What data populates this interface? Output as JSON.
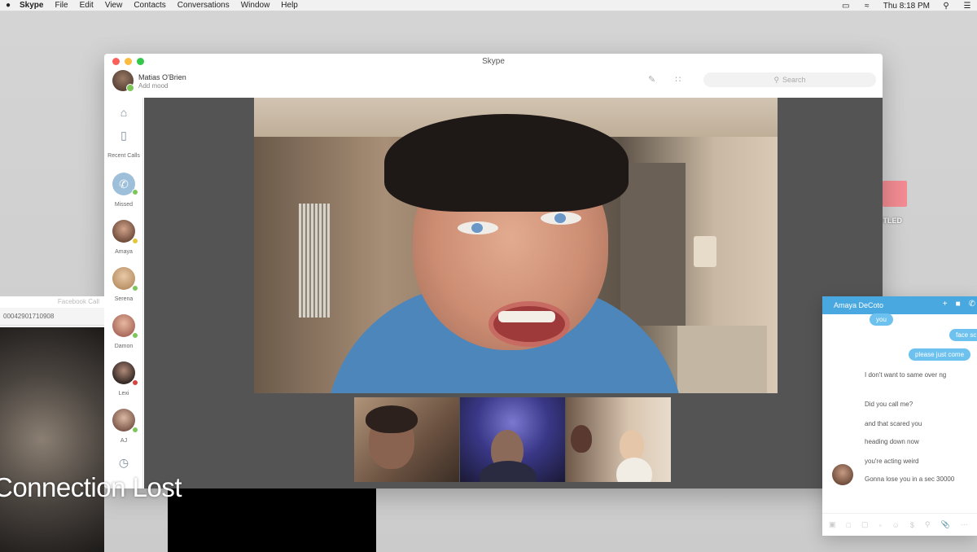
{
  "menubar": {
    "apple": "",
    "items": [
      "Skype",
      "File",
      "Edit",
      "View",
      "Contacts",
      "Conversations",
      "Window",
      "Help"
    ],
    "clock": "Thu 8:18 PM"
  },
  "desktop": {
    "folder_label": "ITLED"
  },
  "skype": {
    "title": "Skype",
    "profile": {
      "name": "Matias O'Brien",
      "mood": "Add mood"
    },
    "search_placeholder": "Search",
    "rail": {
      "recent_label": "Recent Calls",
      "contacts": [
        {
          "label": "Missed",
          "status": "#7cc65a"
        },
        {
          "label": "Amaya",
          "status": "#e3c73b"
        },
        {
          "label": "Serena",
          "status": "#7cc65a"
        },
        {
          "label": "Damon",
          "status": "#7cc65a"
        },
        {
          "label": "Lexi",
          "status": "#d9433d"
        },
        {
          "label": "AJ",
          "status": "#7cc65a"
        }
      ]
    }
  },
  "leftwin": {
    "title": "Facebook Call",
    "id_text": "00042901710908",
    "overlay": "Connection Lost"
  },
  "chat": {
    "contact": "Amaya DeCoto",
    "outgoing": [
      "you",
      "face sc",
      "please just come"
    ],
    "incoming": [
      "I don't want to same over ng",
      "Did you call me?",
      "and that scared you",
      "heading down now",
      "you're acting weird",
      "Gonna lose you in a sec 30000"
    ]
  }
}
